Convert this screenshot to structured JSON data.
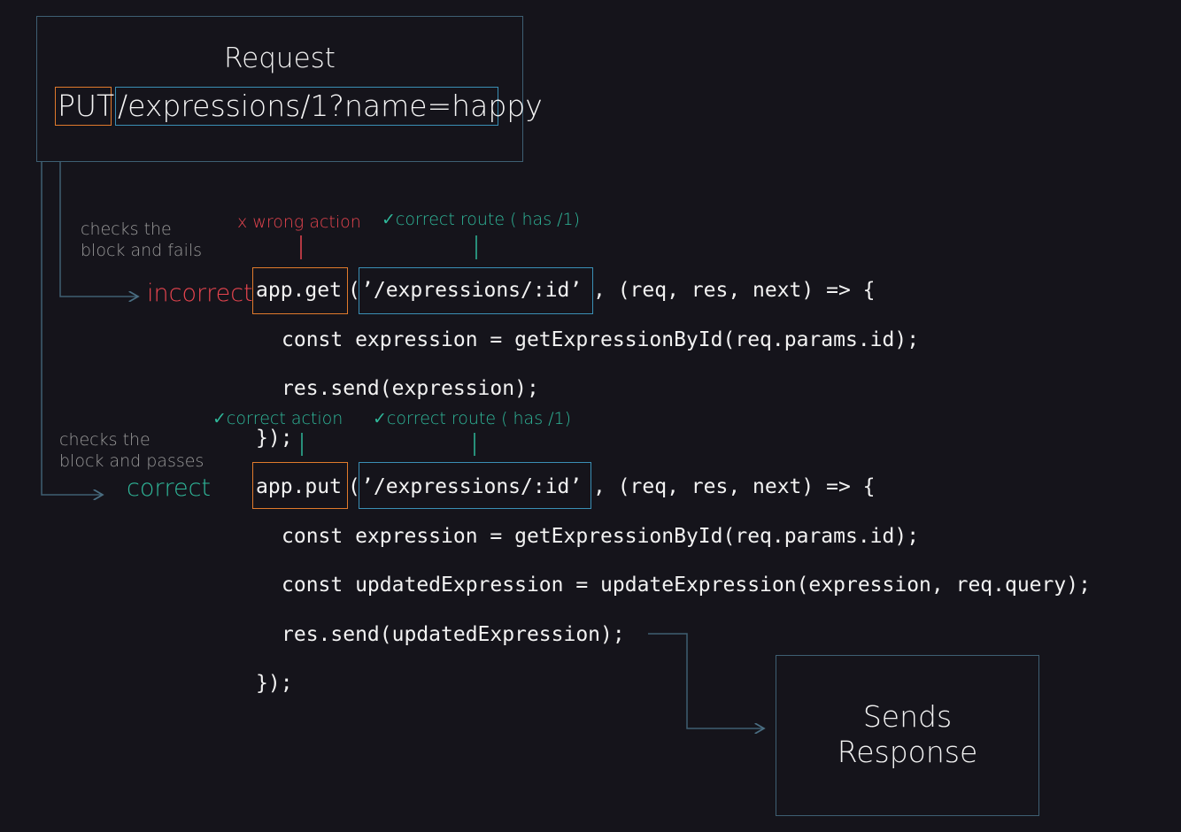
{
  "request": {
    "title": "Request",
    "method": "PUT",
    "url": "/expressions/1?name=happy"
  },
  "incorrect_branch": {
    "note_line1": "checks the",
    "note_line2": "block and fails",
    "label": "incorrect",
    "action_note": "x wrong action",
    "route_check": "✓",
    "route_note": "correct route ( has /1)"
  },
  "correct_branch": {
    "note_line1": "checks the",
    "note_line2": "block and passes",
    "label": "correct",
    "action_check": "✓",
    "action_note": "correct action",
    "route_check": "✓",
    "route_note": "correct route ( has /1)"
  },
  "get_block": {
    "method": "app.get",
    "open_paren": "(",
    "route": "’/expressions/:id’",
    "rest": ", (req, res, next) => {",
    "line2": "const expression = getExpressionById(req.params.id);",
    "line3": "res.send(expression);",
    "close": "});"
  },
  "put_block": {
    "method": "app.put",
    "open_paren": "(",
    "route": "’/expressions/:id’",
    "rest": ", (req, res, next) => {",
    "line2": "const expression = getExpressionById(req.params.id);",
    "line3": "const updatedExpression = updateExpression(expression, req.query);",
    "line4": "res.send(updatedExpression);",
    "close": "});"
  },
  "response": {
    "line1": "Sends",
    "line2": "Response"
  },
  "colors": {
    "background": "#15141b",
    "orange": "#e07a2c",
    "blue": "#3a8fb5",
    "red": "#e8454f",
    "teal": "#2fb89a",
    "connector": "#3e5f73"
  }
}
